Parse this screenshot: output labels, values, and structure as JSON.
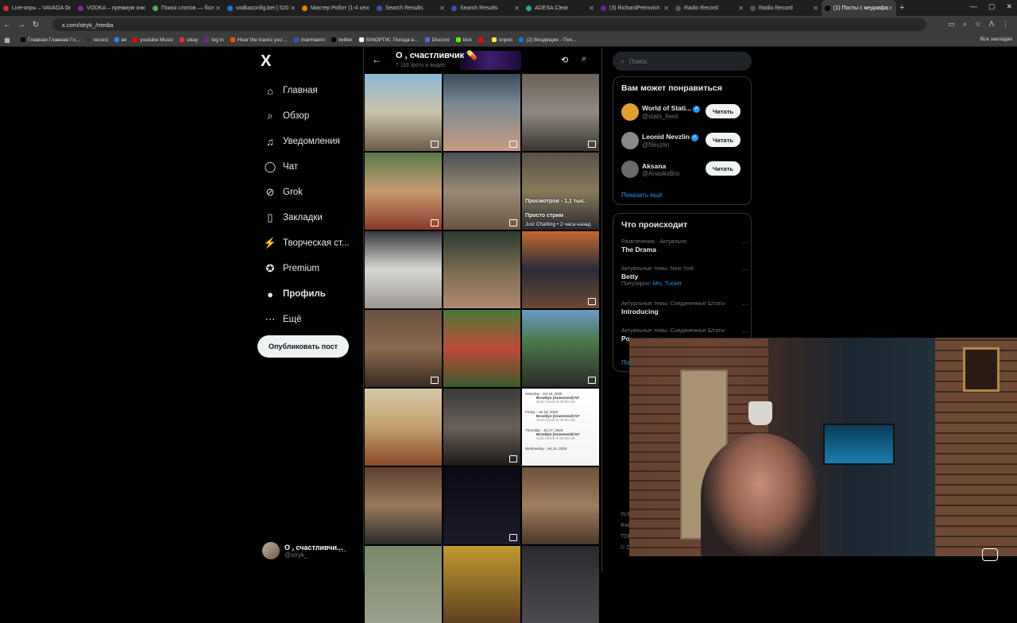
{
  "browser": {
    "tabs": [
      {
        "label": "Live-игры – VAVADA C",
        "color": "#d32f2f"
      },
      {
        "label": "VODKA – премиум он",
        "color": "#8e24aa"
      },
      {
        "label": "Поиск слотов — бол",
        "color": "#4caf50"
      },
      {
        "label": "vodkaconfig.bet | 520",
        "color": "#1976d2"
      },
      {
        "label": "Мистер Робот (1-4 се",
        "color": "#f57c00"
      },
      {
        "label": "Search Results",
        "color": "#3f51b5"
      },
      {
        "label": "Search Results",
        "color": "#3f51b5"
      },
      {
        "label": "ADESA Clear",
        "color": "#26a69a"
      },
      {
        "label": "(3) RichardPetrovich",
        "color": "#7b1fa2"
      },
      {
        "label": "Radio Record",
        "color": "#555555"
      },
      {
        "label": "Radio Record",
        "color": "#555555"
      },
      {
        "label": "(1) Посты с медиафа",
        "color": "#000000",
        "active": true
      }
    ],
    "url": "x.com/stryk_/media",
    "bookmarks": [
      {
        "label": "Главная Главная Гл...",
        "color": "#000000"
      },
      {
        "label": "record",
        "color": "#333333"
      },
      {
        "label": "вк",
        "color": "#2787f5"
      },
      {
        "label": "youtube Music",
        "color": "#ff0000"
      },
      {
        "label": "ebay",
        "color": "#e53238"
      },
      {
        "label": "log in",
        "color": "#7b1fa2"
      },
      {
        "label": "Hear the tracks you'...",
        "color": "#ff5500"
      },
      {
        "label": "manhaeim",
        "color": "#3f51b5"
      },
      {
        "label": "twitter",
        "color": "#000000"
      },
      {
        "label": "SINOPTIK: Погода в...",
        "color": "#ffffff"
      },
      {
        "label": "Discord",
        "color": "#5865f2"
      },
      {
        "label": "kick",
        "color": "#53fc18"
      },
      {
        "label": "",
        "color": "#ff0000"
      },
      {
        "label": "опрос",
        "color": "#ffeb3b"
      },
      {
        "label": "(2) Входящие - Поч...",
        "color": "#1976d2"
      }
    ],
    "all_bookmarks": "Все закладки"
  },
  "sidebar": {
    "logo": "X",
    "items": [
      {
        "label": "Главная",
        "icon": "home-icon",
        "glyph": "⌂"
      },
      {
        "label": "Обзор",
        "icon": "search-icon",
        "glyph": "⌕"
      },
      {
        "label": "Уведомления",
        "icon": "bell-icon",
        "glyph": "♫"
      },
      {
        "label": "Чат",
        "icon": "chat-icon",
        "glyph": "◯"
      },
      {
        "label": "Grok",
        "icon": "grok-icon",
        "glyph": "⊘"
      },
      {
        "label": "Закладки",
        "icon": "bookmark-icon",
        "glyph": "▯"
      },
      {
        "label": "Творческая ст...",
        "icon": "lightning-icon",
        "glyph": "⚡"
      },
      {
        "label": "Premium",
        "icon": "premium-icon",
        "glyph": "✪"
      },
      {
        "label": "Профиль",
        "icon": "profile-icon",
        "glyph": "●"
      },
      {
        "label": "Ещё",
        "icon": "more-icon",
        "glyph": "⋯"
      }
    ],
    "post_button": "Опубликовать пост",
    "account": {
      "name": "О , счастливчи...",
      "handle": "@stryk_",
      "more": "···"
    }
  },
  "main": {
    "title": "О , счастливчик 💊",
    "subtitle": "7 116 фото и видео",
    "tile_overlays": {
      "views": "Просмотров - 1,1 тыс.",
      "stream": "Просто стрим",
      "stream_meta": "Just Chatting • 2 часа назад"
    },
    "schedule": [
      {
        "day": "Saturday - Jul 19, 2025",
        "place": "Brooklyn (Gravesend) NY",
        "time": "Club Check-in 09:00 AM"
      },
      {
        "day": "Friday - Jul 18, 2025",
        "place": "Brooklyn (Gravesend) NY",
        "time": "Club Check-in 09:00 AM"
      },
      {
        "day": "Thursday - Jul 17, 2025",
        "place": "Brooklyn (Gravesend) NY",
        "time": "Club Check-in 08:30 AM"
      },
      {
        "day": "Wednesday - Jul 16, 2025",
        "place": "",
        "time": ""
      }
    ]
  },
  "right": {
    "search_placeholder": "Поиск",
    "wtf_title": "Вам может понравиться",
    "who_to_follow": [
      {
        "name": "World of Stati...",
        "handle": "@stats_feed",
        "verified": true,
        "color": "#e0a030"
      },
      {
        "name": "Leonid Nevzlin",
        "handle": "@Nevzlin",
        "verified": true,
        "color": "#888888"
      },
      {
        "name": "Aksana",
        "handle": "@AnaskoBro",
        "verified": false,
        "color": "#6a6a6a"
      }
    ],
    "follow_label": "Читать",
    "show_more": "Показать ещё",
    "trends_title": "Что происходит",
    "trends": [
      {
        "category": "Развлечения · Актуально",
        "title": "The Drama",
        "popular": "",
        "popular_name": ""
      },
      {
        "category": "Актуальные темы: New York",
        "title": "Betty",
        "popular": "Популярно:",
        "popular_name": "Mrs. Tucker"
      },
      {
        "category": "Актуальные темы: Соединенные Штаты",
        "title": "Introducing",
        "popular": "",
        "popular_name": ""
      },
      {
        "category": "Актуальные темы: Соединенные Штаты",
        "title": "Po",
        "popular": "",
        "popular_name": ""
      }
    ],
    "trend_more": "···",
    "partial_link": "По",
    "footer_fragments": [
      "Усл",
      "Фай",
      "ТОР",
      "© 2"
    ]
  },
  "colors": {
    "accent": "#1d9bf0",
    "background": "#000000",
    "border": "#2f3336"
  }
}
